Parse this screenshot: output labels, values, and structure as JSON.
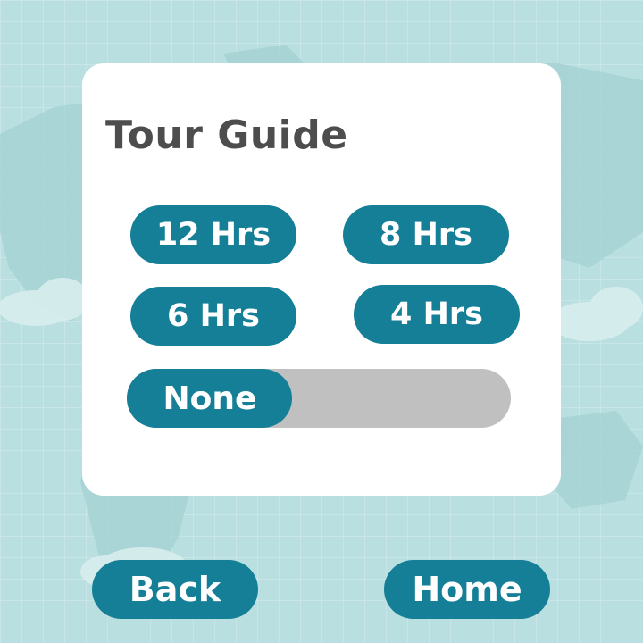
{
  "screen": {
    "title": "Tour Guide"
  },
  "options": [
    {
      "label": "12 Hrs"
    },
    {
      "label": "8 Hrs"
    },
    {
      "label": "6 Hrs"
    },
    {
      "label": "4 Hrs"
    }
  ],
  "selection": {
    "label": "None",
    "fill_fraction": 0.43
  },
  "nav": {
    "back_label": "Back",
    "home_label": "Home"
  },
  "colors": {
    "accent": "#147f96",
    "track": "#c0c0c0",
    "background": "#b9dfe0",
    "card": "#ffffff",
    "title_text": "#4d4d4d"
  },
  "background_icon": "world-map"
}
